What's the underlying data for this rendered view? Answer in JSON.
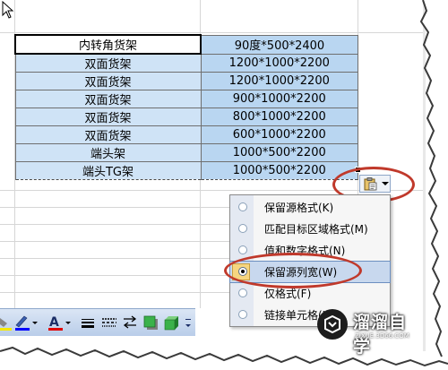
{
  "table": {
    "rows": [
      {
        "name": "内转角货架",
        "size": "90度*500*2400"
      },
      {
        "name": "双面货架",
        "size": "1200*1000*2200"
      },
      {
        "name": "双面货架",
        "size": "1200*1000*2200"
      },
      {
        "name": "双面货架",
        "size": "900*1000*2200"
      },
      {
        "name": "双面货架",
        "size": "800*1000*2200"
      },
      {
        "name": "双面货架",
        "size": "600*1000*2200"
      },
      {
        "name": "端头架",
        "size": "1000*500*2200"
      },
      {
        "name": "端头TG架",
        "size": "1000*500*2200"
      }
    ]
  },
  "paste_menu": {
    "items": [
      {
        "label": "保留源格式(K)",
        "checked": false
      },
      {
        "label": "匹配目标区域格式(M)",
        "checked": false
      },
      {
        "label": "值和数字格式(N)",
        "checked": false
      },
      {
        "label": "保留源列宽(W)",
        "checked": true
      },
      {
        "label": "仅格式(F)",
        "checked": false
      },
      {
        "label": "链接单元格(L)",
        "checked": false
      }
    ]
  },
  "watermark": {
    "title": "溜溜自学",
    "url": "ZIXUE.3D66.COM"
  },
  "colors": {
    "selection": "#b9d6f1",
    "highlight_ring": "#c0392b",
    "menu_gutter": "#e4e9f2"
  },
  "icons": [
    "cursor-arrow-icon",
    "paste-options-icon",
    "radio-icon",
    "fill-color-icon",
    "line-color-icon",
    "font-color-icon",
    "line-style-icon",
    "dash-style-icon",
    "arrow-style-icon",
    "shadow-icon",
    "3d-icon"
  ]
}
